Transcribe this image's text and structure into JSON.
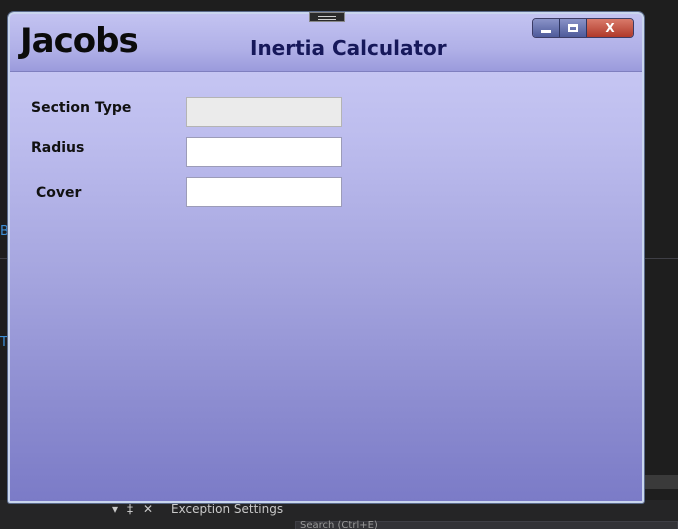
{
  "window": {
    "logo_text": "Jacobs",
    "title": "Inertia Calculator",
    "controls": {
      "minimize_icon": "minimize-icon",
      "maximize_icon": "maximize-icon",
      "close_label": "X"
    }
  },
  "form": {
    "section_type": {
      "label": "Section Type",
      "value": ""
    },
    "radius": {
      "label": "Radius",
      "value": ""
    },
    "cover": {
      "label": "Cover",
      "value": ""
    }
  },
  "background": {
    "left_hint_1": "B",
    "left_hint_2": "T",
    "exception_settings": "Exception Settings",
    "search_placeholder": "Search (Ctrl+E)",
    "panel_icons": [
      "▾",
      "‡",
      "✕"
    ]
  },
  "colors": {
    "title_text": "#16185a",
    "close_button": "#b0392a",
    "window_gradient_top": "#cdcdf7",
    "window_gradient_bottom": "#7b7bc7"
  }
}
